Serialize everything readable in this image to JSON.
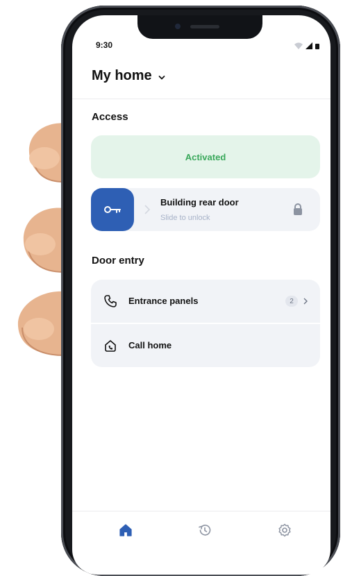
{
  "status_bar": {
    "time": "9:30"
  },
  "header": {
    "title": "My home"
  },
  "access": {
    "section_title": "Access",
    "status_label": "Activated",
    "door": {
      "name": "Building rear door",
      "hint": "Slide to unlock"
    }
  },
  "door_entry": {
    "section_title": "Door entry",
    "items": [
      {
        "label": "Entrance panels",
        "count": "2"
      },
      {
        "label": "Call home"
      }
    ]
  },
  "tab_bar": {
    "tabs": [
      {
        "icon": "home-icon",
        "active": true
      },
      {
        "icon": "history-icon",
        "active": false
      },
      {
        "icon": "settings-icon",
        "active": false
      }
    ]
  },
  "colors": {
    "accent": "#2e5fb4",
    "activated_bg": "#e4f4ea",
    "activated_text": "#39a85b",
    "card_bg": "#f1f3f7"
  }
}
